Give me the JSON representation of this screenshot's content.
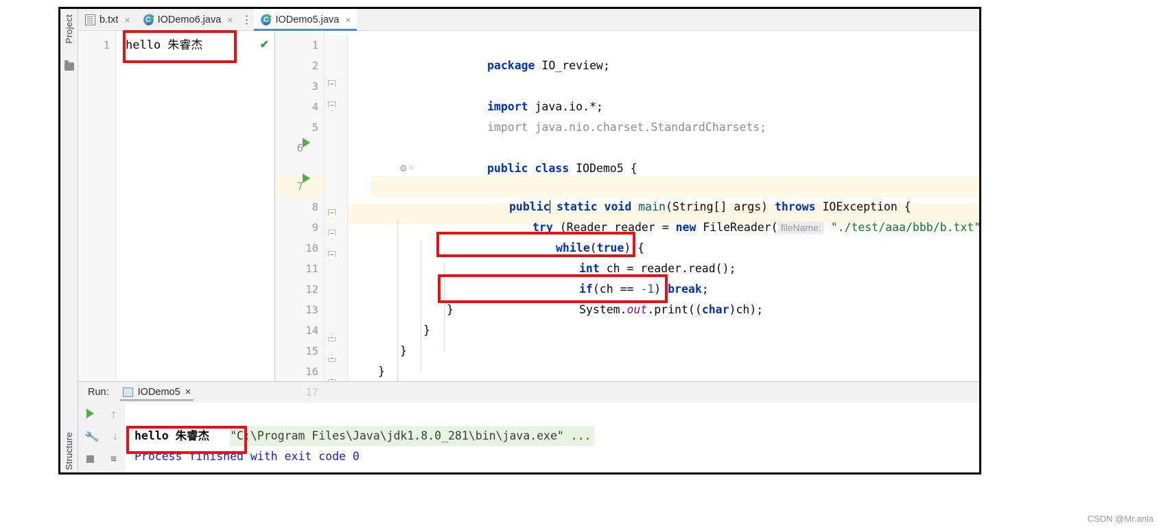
{
  "window": {
    "tool_strip": {
      "project_label": "Project",
      "structure_label": "Structure",
      "folder_icon": "folder-icon"
    }
  },
  "tabs": [
    {
      "label": "b.txt",
      "icon": "text-file-icon",
      "close": "×",
      "active": false
    },
    {
      "label": "IODemo6.java",
      "icon": "java-class-icon",
      "close": "×",
      "active": false
    },
    {
      "label": "IODemo5.java",
      "icon": "java-class-icon",
      "close": "×",
      "active": true
    }
  ],
  "tab_overflow_icon": "⋮",
  "left_editor": {
    "file": "b.txt",
    "line_numbers": [
      "1"
    ],
    "content": "hello 朱睿杰",
    "status_icon": "check-mark-icon",
    "status_glyph": "✔"
  },
  "right_editor": {
    "file": "IODemo5.java",
    "lines": [
      {
        "n": "1",
        "gutter_run": false,
        "fold": "",
        "bulb": false,
        "hl": false
      },
      {
        "n": "2",
        "gutter_run": false,
        "fold": "",
        "bulb": false,
        "hl": false
      },
      {
        "n": "3",
        "gutter_run": false,
        "fold": "minus",
        "bulb": false,
        "hl": false
      },
      {
        "n": "4",
        "gutter_run": false,
        "fold": "v",
        "bulb": false,
        "hl": false
      },
      {
        "n": "5",
        "gutter_run": false,
        "fold": "",
        "bulb": false,
        "hl": false
      },
      {
        "n": "6",
        "gutter_run": true,
        "fold": "",
        "bulb": false,
        "hl": false
      },
      {
        "n": "7",
        "gutter_run": true,
        "fold": "minus",
        "bulb": true,
        "hl": true
      },
      {
        "n": "8",
        "gutter_run": false,
        "fold": "minus",
        "bulb": false,
        "hl": false
      },
      {
        "n": "9",
        "gutter_run": false,
        "fold": "minus",
        "bulb": false,
        "hl": false
      },
      {
        "n": "10",
        "gutter_run": false,
        "fold": "",
        "bulb": false,
        "hl": false
      },
      {
        "n": "11",
        "gutter_run": false,
        "fold": "",
        "bulb": false,
        "hl": false
      },
      {
        "n": "12",
        "gutter_run": false,
        "fold": "",
        "bulb": false,
        "hl": false
      },
      {
        "n": "13",
        "gutter_run": false,
        "fold": "v",
        "bulb": false,
        "hl": false
      },
      {
        "n": "14",
        "gutter_run": false,
        "fold": "v",
        "bulb": false,
        "hl": false
      },
      {
        "n": "15",
        "gutter_run": false,
        "fold": "v",
        "bulb": false,
        "hl": false
      },
      {
        "n": "16",
        "gutter_run": false,
        "fold": "",
        "bulb": false,
        "hl": false
      },
      {
        "n": "17",
        "gutter_run": false,
        "fold": "",
        "bulb": false,
        "hl": false
      }
    ],
    "code": {
      "l1_package": "package",
      "l1_name": " IO_review;",
      "l3_import": "import",
      "l3_pkg": " java.io.*;",
      "l4": "import java.nio.charset.StandardCharsets;",
      "l6_public": "public",
      "l6_class": "class",
      "l6_name": "IODemo5 {",
      "inlay_gear": "run-config-gear-icon",
      "inlay_chevron": "˅",
      "l7_public": "public",
      "l7_static": "static",
      "l7_void": "void",
      "l7_main": "main",
      "l7_params": "(String[] args) ",
      "l7_throws": "throws",
      "l7_exc": " IOException {",
      "l8_try": "try",
      "l8_a": " (Reader reader = ",
      "l8_new": "new",
      "l8_b": " FileReader(",
      "l8_hint": "fileName:",
      "l8_str": "\"./test/aaa/bbb/b.txt\"",
      "l8_c": ")) {",
      "l9_while": "while",
      "l9_a": "(",
      "l9_true": "true",
      "l9_b": ") {",
      "l10_int": "int",
      "l10_rest": " ch = reader.read();",
      "l11_if": "if",
      "l11_a": "(ch == ",
      "l11_num": "-1",
      "l11_b": ") ",
      "l11_break": "break",
      "l11_c": ";",
      "l12_a": "System.",
      "l12_out": "out",
      "l12_b": ".print((",
      "l12_char": "char",
      "l12_c": ")ch);",
      "l13": "}",
      "l14": "}",
      "l15": "}",
      "l16": "}"
    }
  },
  "run_window": {
    "title": "Run:",
    "tab_label": "IODemo5",
    "tab_icon": "console-icon",
    "tab_close": "×",
    "toolbar": {
      "rerun_icon": "run-play-icon",
      "scroll_up_icon": "↑",
      "scroll_down_icon": "↓",
      "settings_icon": "wrench-icon",
      "stop_icon": "stop-square-icon",
      "soft_wrap_icon": "≡"
    },
    "output": [
      {
        "text": "\"C:\\Program Files\\Java\\jdk1.8.0_281\\bin\\java.exe\" ...",
        "style": "cmd"
      },
      {
        "text": "hello 朱睿杰",
        "style": "out"
      },
      {
        "text": "Process finished with exit code 0",
        "style": "fin"
      }
    ]
  },
  "annotations": {
    "boxes": [
      {
        "name": "left-editor-output-box"
      },
      {
        "name": "line10-box"
      },
      {
        "name": "line12-box"
      },
      {
        "name": "console-output-box"
      }
    ],
    "color": "#e81010"
  },
  "watermark": "CSDN @Mr.anla"
}
